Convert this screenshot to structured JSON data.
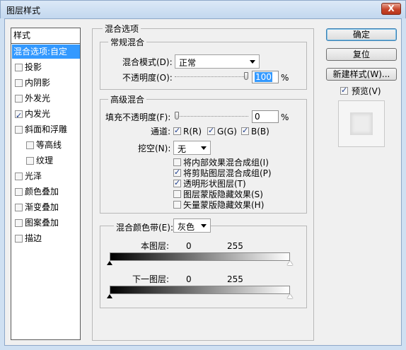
{
  "window": {
    "title": "图层样式",
    "close": "X"
  },
  "sidebar": {
    "header": "样式",
    "items": [
      {
        "label": "混合选项:自定",
        "selected": true,
        "has_checkbox": false
      },
      {
        "label": "投影",
        "checked": false
      },
      {
        "label": "内阴影",
        "checked": false
      },
      {
        "label": "外发光",
        "checked": false
      },
      {
        "label": "内发光",
        "checked": true
      },
      {
        "label": "斜面和浮雕",
        "checked": false
      },
      {
        "label": "等高线",
        "checked": false,
        "sub": true
      },
      {
        "label": "纹理",
        "checked": false,
        "sub": true
      },
      {
        "label": "光泽",
        "checked": false
      },
      {
        "label": "颜色叠加",
        "checked": false
      },
      {
        "label": "渐变叠加",
        "checked": false
      },
      {
        "label": "图案叠加",
        "checked": false
      },
      {
        "label": "描边",
        "checked": false
      }
    ]
  },
  "blend_options": {
    "title": "混合选项",
    "general": {
      "title": "常规混合",
      "mode_label": "混合模式(D):",
      "mode_value": "正常",
      "opacity_label": "不透明度(O):",
      "opacity_value": "100",
      "opacity_unit": "%",
      "opacity_level": 100
    },
    "advanced": {
      "title": "高级混合",
      "fill_label": "填充不透明度(F):",
      "fill_value": "0",
      "fill_unit": "%",
      "fill_level": 0,
      "channels_label": "通道:",
      "channels": [
        {
          "label": "R(R)",
          "checked": true
        },
        {
          "label": "G(G)",
          "checked": true
        },
        {
          "label": "B(B)",
          "checked": true
        }
      ],
      "knockout_label": "挖空(N):",
      "knockout_value": "无",
      "options": [
        {
          "label": "将内部效果混合成组(I)",
          "checked": false
        },
        {
          "label": "将剪贴图层混合成组(P)",
          "checked": true
        },
        {
          "label": "透明形状图层(T)",
          "checked": true
        },
        {
          "label": "图层蒙版隐藏效果(S)",
          "checked": false
        },
        {
          "label": "矢量蒙版隐藏效果(H)",
          "checked": false
        }
      ]
    },
    "blend_if": {
      "label": "混合颜色带(E):",
      "value": "灰色",
      "this_layer": {
        "label": "本图层:",
        "min": "0",
        "max": "255"
      },
      "under_layer": {
        "label": "下一图层:",
        "min": "0",
        "max": "255"
      }
    }
  },
  "buttons": {
    "ok": "确定",
    "reset": "复位",
    "new_style": "新建样式(W)...",
    "preview_label": "预览(V)",
    "preview_checked": true
  }
}
